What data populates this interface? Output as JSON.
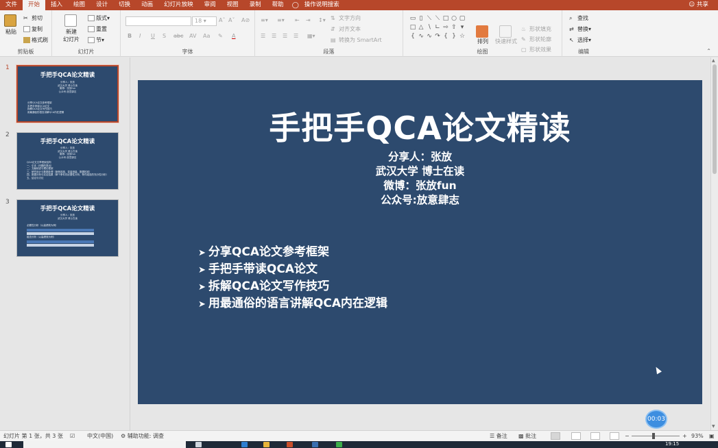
{
  "ribbon_tabs": [
    "文件",
    "开始",
    "插入",
    "绘图",
    "设计",
    "切换",
    "动画",
    "幻灯片放映",
    "审阅",
    "视图",
    "录制",
    "帮助",
    "操作说明搜索"
  ],
  "active_tab": "开始",
  "share_label": "共享",
  "clipboard": {
    "paste": "粘贴",
    "cut": "剪切",
    "copy": "复制",
    "format_painter": "格式刷",
    "label": "剪贴板"
  },
  "slides_group": {
    "new_slide": "新建",
    "new_slide_2": "幻灯片",
    "layout": "版式",
    "reset": "重置",
    "section": "节",
    "label": "幻灯片"
  },
  "font_group": {
    "font_size": "18",
    "bold": "B",
    "italic": "I",
    "underline": "U",
    "shadow": "S",
    "strike": "abc",
    "label": "字体"
  },
  "paragraph_group": {
    "text_direction": "文字方向",
    "align_text": "对齐文本",
    "smartart": "转换为 SmartArt",
    "label": "段落"
  },
  "drawing_group": {
    "arrange": "排列",
    "quick_styles": "快速样式",
    "shape_fill": "形状填充",
    "shape_outline": "形状轮廓",
    "shape_effects": "形状效果",
    "label": "绘图"
  },
  "editing_group": {
    "find": "查找",
    "replace": "替换",
    "select": "选择",
    "label": "编辑"
  },
  "thumbnails": [
    {
      "num": "1",
      "title": "手把手QCA论文精读",
      "sub": [
        "分享人：张放",
        "武汉大学 博士在读",
        "微博：张放fun",
        "公众号:放意肆志"
      ],
      "bullets": [
        "分享QCA论文参考框架",
        "手把手带读QCA论文",
        "拆解QCA论文写作技巧",
        "用最通俗的语言讲解QCA内在逻辑"
      ]
    },
    {
      "num": "2",
      "title": "手把手QCA论文精读",
      "sub": [
        "分享人：张放",
        "武汉大学 博士在读",
        "微博：张放fun",
        "公众号:放意肆志"
      ],
      "bullets": [
        "QCA论文文章框架结构",
        "一、引言（问题的提出）",
        "二、文献综述与理论框架",
        "三、研究设计与数据处理（案例选择、变量测量、数据校准）",
        "四、数据分析与实证结果（单个条件的必要性分析、条件组态的充分性分析）",
        "五、结论与讨论"
      ]
    },
    {
      "num": "3",
      "title": "手把手QCA论文精读",
      "sub": [
        "分享人：张放",
        "武汉大学 博士在读"
      ],
      "captions": [
        "必要性分析（以高绩效为例）",
        "组态分析（以高绩效为例）"
      ]
    }
  ],
  "slide": {
    "title": "手把手QCA论文精读",
    "info": [
      "分享人：张放",
      "武汉大学 博士在读",
      "微博：张放fun",
      "公众号:放意肆志"
    ],
    "bullets": [
      "分享QCA论文参考框架",
      "手把手带读QCA论文",
      "拆解QCA论文写作技巧",
      "用最通俗的语言讲解QCA内在逻辑"
    ],
    "background_color": "#2d4a6e"
  },
  "timer": "00:03",
  "statusbar": {
    "slide_info": "幻灯片 第 1 张，共 3 张",
    "language": "中文(中国)",
    "accessibility": "辅助功能: 调查",
    "notes": "备注",
    "comments": "批注",
    "zoom": "93%"
  },
  "taskbar": {
    "time": "19:15"
  },
  "accent": "#b7472a"
}
